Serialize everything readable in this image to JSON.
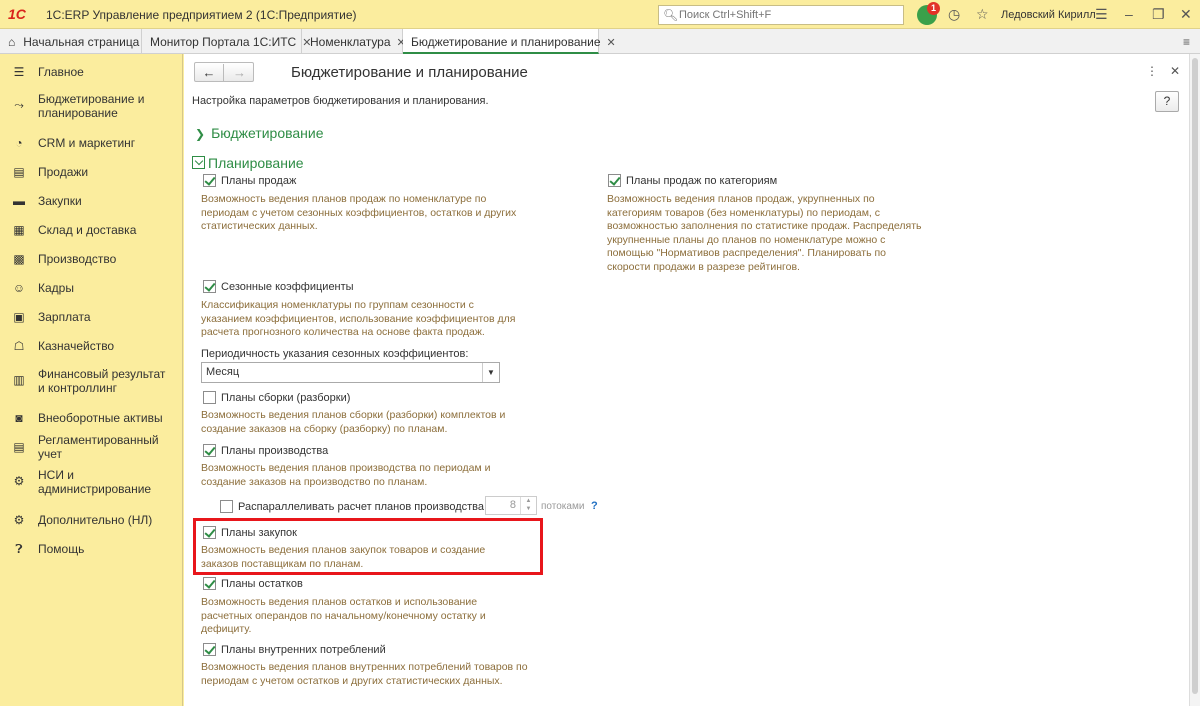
{
  "titlebar": {
    "logo": "1С",
    "app_title": "1С:ERP Управление предприятием 2  (1С:Предприятие)",
    "search_placeholder": "Поиск Ctrl+Shift+F",
    "notification_count": "1",
    "user_name": "Ледовский Кирилл",
    "icons": [
      "bell-icon",
      "history-icon",
      "star-icon",
      "menu-icon",
      "minimize-icon",
      "restore-icon",
      "close-icon"
    ]
  },
  "tabs": [
    {
      "label": "Начальная страница"
    },
    {
      "label": "Монитор Портала 1С:ИТС"
    },
    {
      "label": "Номенклатура"
    },
    {
      "label": "Бюджетирование и планирование"
    }
  ],
  "sidebar": {
    "items": [
      {
        "label": "Главное",
        "icon": "menu-icon"
      },
      {
        "label": "Бюджетирование и планирование",
        "icon": "budget-icon"
      },
      {
        "label": "CRM и маркетинг",
        "icon": "pie-chart-icon"
      },
      {
        "label": "Продажи",
        "icon": "cart-icon"
      },
      {
        "label": "Закупки",
        "icon": "truck-icon"
      },
      {
        "label": "Склад и доставка",
        "icon": "warehouse-icon"
      },
      {
        "label": "Производство",
        "icon": "factory-icon"
      },
      {
        "label": "Кадры",
        "icon": "person-icon"
      },
      {
        "label": "Зарплата",
        "icon": "money-icon"
      },
      {
        "label": "Казначейство",
        "icon": "bank-icon"
      },
      {
        "label": "Финансовый результат и контроллинг",
        "icon": "finance-icon"
      },
      {
        "label": "Внеоборотные активы",
        "icon": "car-icon"
      },
      {
        "label": "Регламентированный учет",
        "icon": "ledger-icon"
      },
      {
        "label": "НСИ и администрирование",
        "icon": "gear-icon"
      },
      {
        "label": "Дополнительно (НЛ)",
        "icon": "gear-outline-icon"
      },
      {
        "label": "Помощь",
        "icon": "help-icon"
      }
    ]
  },
  "main": {
    "title": "Бюджетирование и планирование",
    "subtitle": "Настройка параметров бюджетирования и планирования.",
    "help_label": "?",
    "section_budget": "Бюджетирование",
    "section_planning": "Планирование",
    "sales_plans": {
      "label": "Планы продаж",
      "checked": true,
      "desc": [
        "Возможность ведения планов продаж по номенклатуре по",
        "периодам с учетом сезонных коэффициентов, остатков и других",
        "статистических данных."
      ]
    },
    "sales_plans_category": {
      "label": "Планы продаж по категориям",
      "checked": true,
      "desc": [
        "Возможность ведения планов продаж, укрупненных по",
        "категориям товаров (без номенклатуры) по периодам, с",
        "возможностью заполнения по статистике продаж. Распределять",
        "укрупненные планы до планов по номенклатуре можно с",
        "помощью \"Нормативов распределения\". Планировать по",
        "скорости продажи в разрезе рейтингов."
      ]
    },
    "seasonal": {
      "label": "Сезонные коэффициенты",
      "checked": true,
      "desc": [
        "Классификация номенклатуры по группам сезонности с",
        "указанием коэффициентов, использование коэффициентов для",
        "расчета прогнозного количества на основе факта продаж."
      ]
    },
    "periodicity": {
      "label": "Периодичность указания сезонных коэффициентов:",
      "value": "Месяц"
    },
    "assembly": {
      "label": "Планы сборки (разборки)",
      "checked": false,
      "desc": [
        "Возможность ведения планов сборки (разборки) комплектов и",
        "создание заказов на сборку (разборку) по планам."
      ]
    },
    "production": {
      "label": "Планы производства",
      "checked": true,
      "desc": [
        "Возможность ведения планов производства по периодам и",
        "создание заказов на производство по планам."
      ]
    },
    "parallel": {
      "label": "Распараллеливать расчет планов производства",
      "checked": false,
      "threads": "8",
      "suffix": "потоками",
      "help": "?"
    },
    "purchase": {
      "label": "Планы закупок",
      "checked": true,
      "desc": [
        "Возможность ведения планов закупок товаров и создание",
        "заказов поставщикам по планам."
      ]
    },
    "stock": {
      "label": "Планы остатков",
      "checked": true,
      "desc": [
        "Возможность ведения планов остатков и использование",
        "расчетных операндов по начальному/конечному остатку и",
        "дефициту."
      ]
    },
    "internal": {
      "label": "Планы внутренних потреблений",
      "checked": true,
      "desc": [
        "Возможность ведения планов внутренних потреблений товаров по",
        "периодам с учетом остатков и других статистических данных."
      ]
    }
  }
}
